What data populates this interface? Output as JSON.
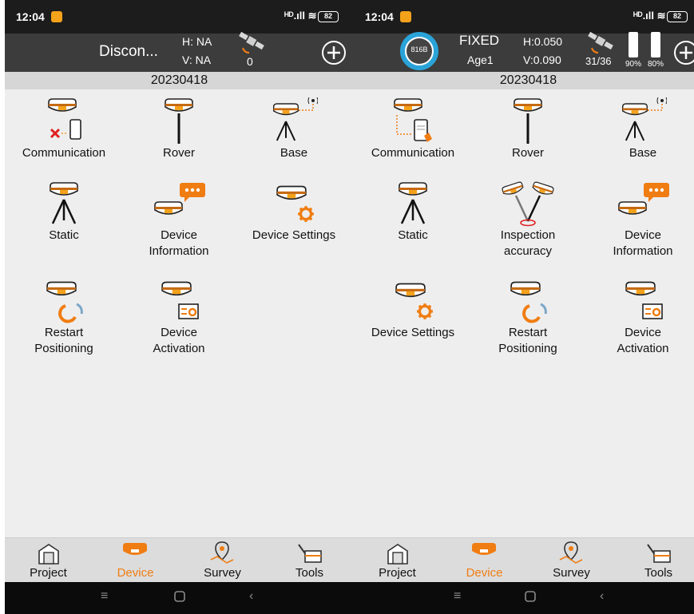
{
  "colors": {
    "accent": "#f07d12",
    "header_bg": "#3c3c3c",
    "status_bg": "#1c1c1c",
    "ring": "#2aa3d8"
  },
  "left": {
    "status": {
      "time": "12:04",
      "signal": "ᴴᴰ.ıll ≋",
      "battery": "82"
    },
    "header": {
      "connection": "Discon...",
      "h": "H: NA",
      "v": "V: NA",
      "sat_count": "0"
    },
    "date": "20230418",
    "items": [
      {
        "label": "Communication",
        "icon": "disconnected-communication-icon"
      },
      {
        "label": "Rover",
        "icon": "rover-icon"
      },
      {
        "label": "Base",
        "icon": "base-station-icon"
      },
      {
        "label": "Static",
        "icon": "static-tripod-icon"
      },
      {
        "label": "Device\nInformation",
        "icon": "device-information-icon"
      },
      {
        "label": "Device Settings",
        "icon": "device-settings-icon"
      },
      {
        "label": "Restart\nPositioning",
        "icon": "restart-positioning-icon"
      },
      {
        "label": "Device\nActivation",
        "icon": "device-activation-icon"
      }
    ],
    "nav": [
      "Project",
      "Device",
      "Survey",
      "Tools"
    ],
    "active_nav": "Device"
  },
  "right": {
    "status": {
      "time": "12:04",
      "signal": "ᴴᴰ.ıll ≋",
      "battery": "82"
    },
    "header": {
      "ring_value": "816B",
      "fix": "FIXED",
      "age": "Age1",
      "h": "H:0.050",
      "v": "V:0.090",
      "sats": "31/36",
      "batt1": "90%",
      "batt2": "80%"
    },
    "date": "20230418",
    "items": [
      {
        "label": "Communication",
        "icon": "connected-communication-icon"
      },
      {
        "label": "Rover",
        "icon": "rover-icon"
      },
      {
        "label": "Base",
        "icon": "base-station-icon"
      },
      {
        "label": "Static",
        "icon": "static-tripod-icon"
      },
      {
        "label": "Inspection\naccuracy",
        "icon": "inspection-accuracy-icon"
      },
      {
        "label": "Device\nInformation",
        "icon": "device-information-icon"
      },
      {
        "label": "Device Settings",
        "icon": "device-settings-icon"
      },
      {
        "label": "Restart\nPositioning",
        "icon": "restart-positioning-icon"
      },
      {
        "label": "Device\nActivation",
        "icon": "device-activation-icon"
      }
    ],
    "nav": [
      "Project",
      "Device",
      "Survey",
      "Tools"
    ],
    "active_nav": "Device"
  }
}
